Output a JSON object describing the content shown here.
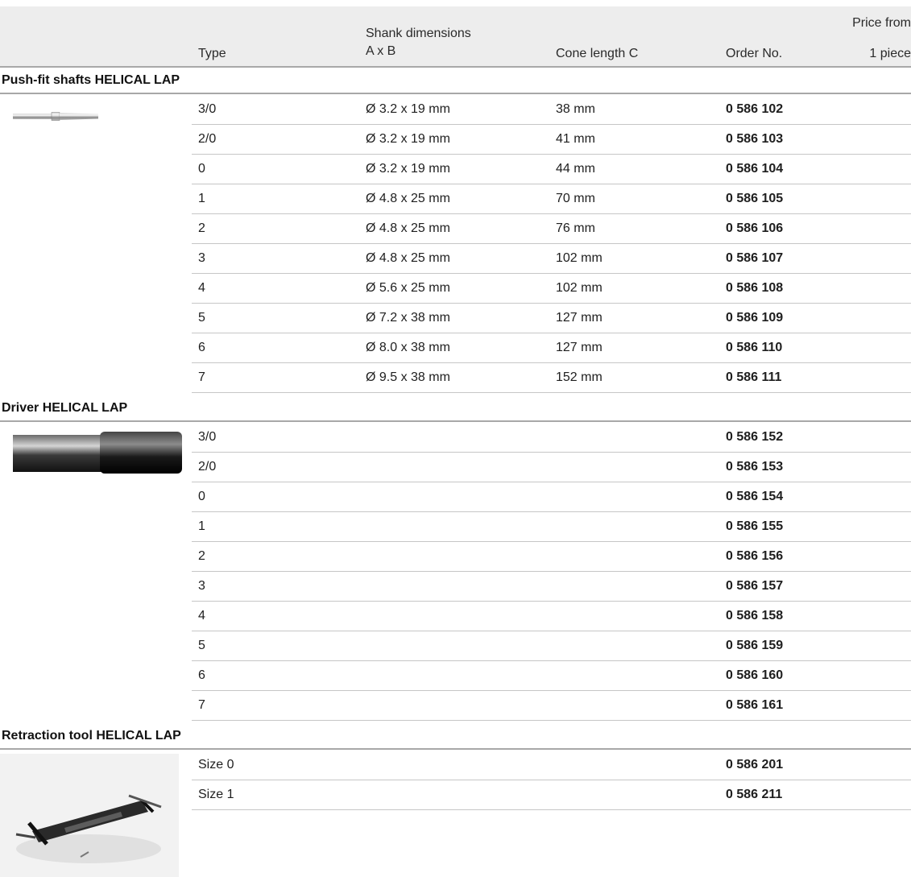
{
  "header": {
    "type": "Type",
    "shank_line1": "Shank dimensions",
    "shank_line2": "A x B",
    "cone": "Cone length C",
    "order": "Order No.",
    "price_line1": "Price from",
    "price_line2": "1 piece"
  },
  "sections": [
    {
      "title": "Push-fit shafts HELICAL LAP",
      "image": "push-fit-shaft",
      "rows": [
        {
          "type": "3/0",
          "shank": "Ø 3.2 x 19 mm",
          "cone": "38 mm",
          "order": "0 586 102"
        },
        {
          "type": "2/0",
          "shank": "Ø 3.2 x 19 mm",
          "cone": "41 mm",
          "order": "0 586 103"
        },
        {
          "type": "0",
          "shank": "Ø 3.2 x 19 mm",
          "cone": "44 mm",
          "order": "0 586 104"
        },
        {
          "type": "1",
          "shank": "Ø 4.8 x 25 mm",
          "cone": "70 mm",
          "order": "0 586 105"
        },
        {
          "type": "2",
          "shank": "Ø 4.8 x 25 mm",
          "cone": "76 mm",
          "order": "0 586 106"
        },
        {
          "type": "3",
          "shank": "Ø 4.8 x 25 mm",
          "cone": "102 mm",
          "order": "0 586 107"
        },
        {
          "type": "4",
          "shank": "Ø 5.6 x 25 mm",
          "cone": "102 mm",
          "order": "0 586 108"
        },
        {
          "type": "5",
          "shank": "Ø 7.2 x 38 mm",
          "cone": "127 mm",
          "order": "0 586 109"
        },
        {
          "type": "6",
          "shank": "Ø 8.0 x 38 mm",
          "cone": "127 mm",
          "order": "0 586 110"
        },
        {
          "type": "7",
          "shank": "Ø 9.5 x 38 mm",
          "cone": "152 mm",
          "order": "0 586 111"
        }
      ]
    },
    {
      "title": "Driver HELICAL LAP",
      "image": "driver",
      "rows": [
        {
          "type": "3/0",
          "order": "0 586 152"
        },
        {
          "type": "2/0",
          "order": "0 586 153"
        },
        {
          "type": "0",
          "order": "0 586 154"
        },
        {
          "type": "1",
          "order": "0 586 155"
        },
        {
          "type": "2",
          "order": "0 586 156"
        },
        {
          "type": "3",
          "order": "0 586 157"
        },
        {
          "type": "4",
          "order": "0 586 158"
        },
        {
          "type": "5",
          "order": "0 586 159"
        },
        {
          "type": "6",
          "order": "0 586 160"
        },
        {
          "type": "7",
          "order": "0 586 161"
        }
      ]
    },
    {
      "title": "Retraction tool HELICAL LAP",
      "image": "retraction-tool",
      "rows": [
        {
          "type": "Size 0",
          "order": "0 586 201"
        },
        {
          "type": "Size 1",
          "order": "0 586 211"
        }
      ]
    }
  ]
}
